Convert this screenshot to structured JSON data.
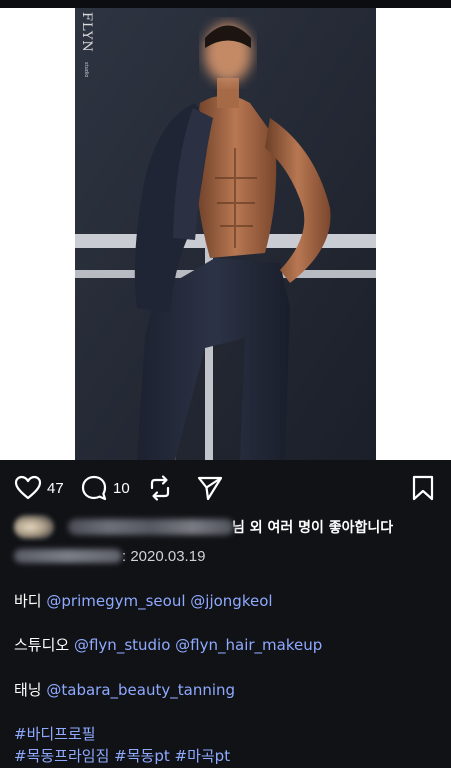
{
  "post": {
    "brand_logo": "FLYN",
    "brand_sub": "studio"
  },
  "actions": {
    "like_count": "47",
    "comment_count": "10"
  },
  "likes": {
    "suffix": "님 외 여러 명이 좋아합니다"
  },
  "date": {
    "text": ": 2020.03.19"
  },
  "caption": {
    "body_label": "바디",
    "body_mentions": [
      "@primegym_seoul",
      "@jjongkeol"
    ],
    "studio_label": "스튜디오",
    "studio_mentions": [
      "@flyn_studio",
      "@flyn_hair_makeup"
    ],
    "tanning_label": "태닝",
    "tanning_mentions": [
      "@tabara_beauty_tanning"
    ],
    "hashtags_line1": "#바디프로필",
    "hashtags_line2": [
      "#목동프라임짐",
      "#목동pt",
      "#마곡pt"
    ]
  },
  "icons": {
    "like": "heart-icon",
    "comment": "comment-icon",
    "repost": "repost-icon",
    "share": "send-icon",
    "save": "bookmark-icon"
  },
  "colors": {
    "background": "#101216",
    "mention": "#8fa9ff",
    "text": "#ffffff"
  }
}
